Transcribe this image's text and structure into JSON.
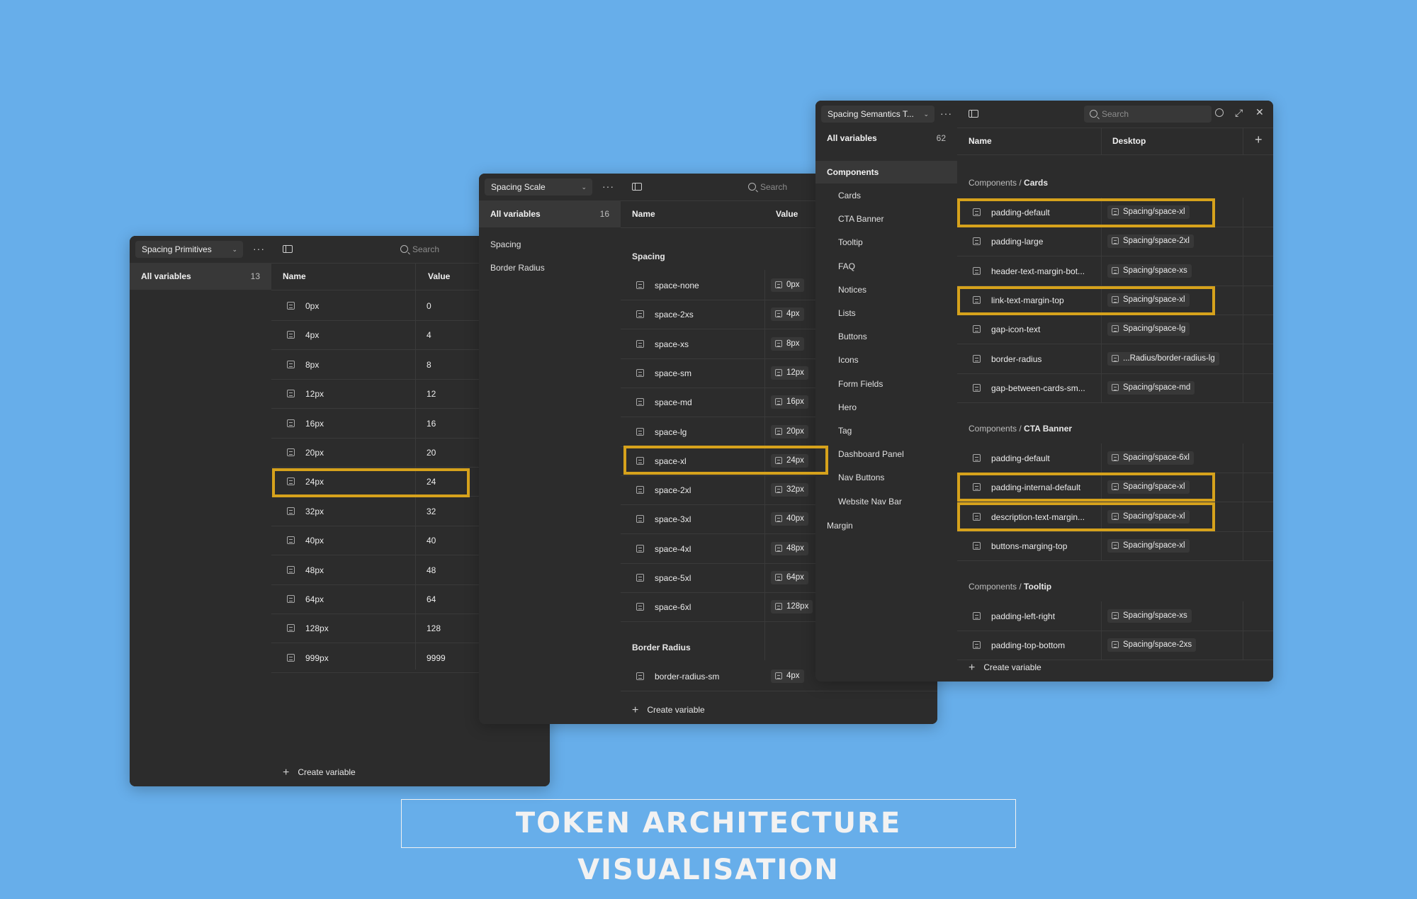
{
  "colors": {
    "background": "#67aeea",
    "panel": "#2c2c2c",
    "highlight": "#d6a21c"
  },
  "title": "TOKEN ARCHITECTURE VISUALISATION",
  "primitives": {
    "collection": "Spacing Primitives",
    "all_variables": "All variables",
    "count": "13",
    "search_placeholder": "Search",
    "col_name": "Name",
    "col_value": "Value",
    "rows": [
      {
        "name": "0px",
        "value": "0"
      },
      {
        "name": "4px",
        "value": "4"
      },
      {
        "name": "8px",
        "value": "8"
      },
      {
        "name": "12px",
        "value": "12"
      },
      {
        "name": "16px",
        "value": "16"
      },
      {
        "name": "20px",
        "value": "20"
      },
      {
        "name": "24px",
        "value": "24"
      },
      {
        "name": "32px",
        "value": "32"
      },
      {
        "name": "40px",
        "value": "40"
      },
      {
        "name": "48px",
        "value": "48"
      },
      {
        "name": "64px",
        "value": "64"
      },
      {
        "name": "128px",
        "value": "128"
      },
      {
        "name": "999px",
        "value": "9999"
      }
    ],
    "create": "Create variable"
  },
  "scale": {
    "collection": "Spacing Scale",
    "all_variables": "All variables",
    "count": "16",
    "groups": [
      "Spacing",
      "Border Radius"
    ],
    "search_placeholder": "Search",
    "col_name": "Name",
    "col_value": "Value",
    "section_spacing": "Spacing",
    "rows": [
      {
        "name": "space-none",
        "value": "0px"
      },
      {
        "name": "space-2xs",
        "value": "4px"
      },
      {
        "name": "space-xs",
        "value": "8px"
      },
      {
        "name": "space-sm",
        "value": "12px"
      },
      {
        "name": "space-md",
        "value": "16px"
      },
      {
        "name": "space-lg",
        "value": "20px"
      },
      {
        "name": "space-xl",
        "value": "24px"
      },
      {
        "name": "space-2xl",
        "value": "32px"
      },
      {
        "name": "space-3xl",
        "value": "40px"
      },
      {
        "name": "space-4xl",
        "value": "48px"
      },
      {
        "name": "space-5xl",
        "value": "64px"
      },
      {
        "name": "space-6xl",
        "value": "128px"
      }
    ],
    "section_radius": "Border Radius",
    "radius_rows": [
      {
        "name": "border-radius-sm",
        "value": "4px"
      }
    ],
    "create": "Create variable"
  },
  "semantics": {
    "collection": "Spacing Semantics T...",
    "all_variables": "All variables",
    "count": "62",
    "components_label": "Components",
    "sub_groups": [
      "Cards",
      "CTA Banner",
      "Tooltip",
      "FAQ",
      "Notices",
      "Lists",
      "Buttons",
      "Icons",
      "Form Fields",
      "Hero",
      "Tag",
      "Dashboard Panel",
      "Nav Buttons",
      "Website Nav Bar"
    ],
    "margin_label": "Margin",
    "search_placeholder": "Search",
    "col_name": "Name",
    "col_desktop": "Desktop",
    "section_prefix": "Components / ",
    "sections": [
      {
        "title": "Cards",
        "rows": [
          {
            "name": "padding-default",
            "value": "Spacing/space-xl"
          },
          {
            "name": "padding-large",
            "value": "Spacing/space-2xl"
          },
          {
            "name": "header-text-margin-bot...",
            "value": "Spacing/space-xs"
          },
          {
            "name": "link-text-margin-top",
            "value": "Spacing/space-xl"
          },
          {
            "name": "gap-icon-text",
            "value": "Spacing/space-lg"
          },
          {
            "name": "border-radius",
            "value": "...Radius/border-radius-lg"
          },
          {
            "name": "gap-between-cards-sm...",
            "value": "Spacing/space-md"
          }
        ]
      },
      {
        "title": "CTA Banner",
        "rows": [
          {
            "name": "padding-default",
            "value": "Spacing/space-6xl"
          },
          {
            "name": "padding-internal-default",
            "value": "Spacing/space-xl"
          },
          {
            "name": "description-text-margin...",
            "value": "Spacing/space-xl"
          },
          {
            "name": "buttons-marging-top",
            "value": "Spacing/space-xl"
          }
        ]
      },
      {
        "title": "Tooltip",
        "rows": [
          {
            "name": "padding-left-right",
            "value": "Spacing/space-xs"
          },
          {
            "name": "padding-top-bottom",
            "value": "Spacing/space-2xs"
          }
        ]
      }
    ],
    "create": "Create variable"
  }
}
